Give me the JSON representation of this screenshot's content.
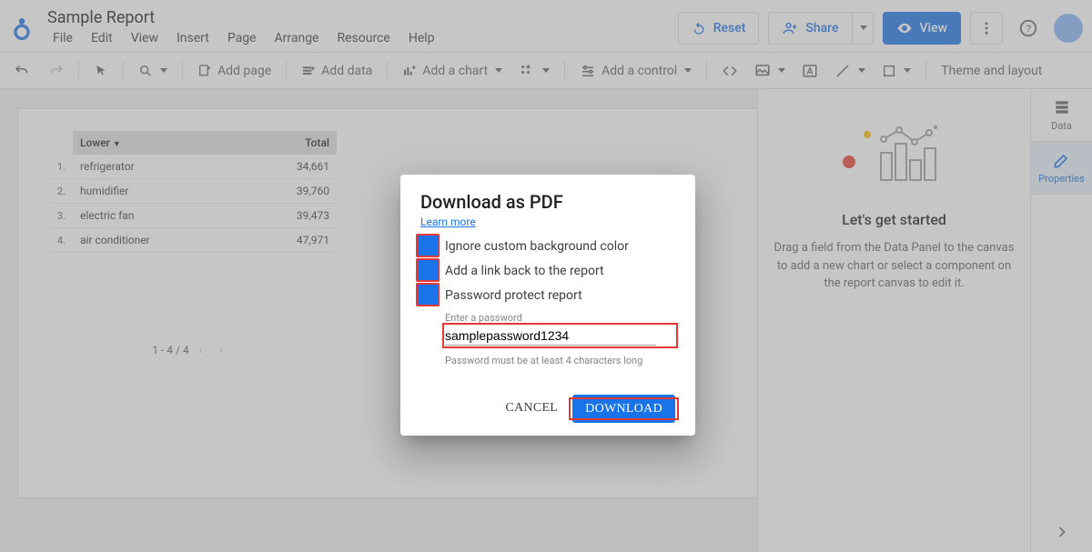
{
  "header": {
    "title": "Sample Report",
    "menus": [
      "File",
      "Edit",
      "View",
      "Insert",
      "Page",
      "Arrange",
      "Resource",
      "Help"
    ],
    "reset": "Reset",
    "share": "Share",
    "view": "View"
  },
  "toolbar": {
    "add_page": "Add page",
    "add_data": "Add data",
    "add_chart": "Add a chart",
    "add_control": "Add a control",
    "theme": "Theme and layout"
  },
  "table": {
    "col_sort": "Lower",
    "col_total": "Total",
    "rows": [
      {
        "i": "1.",
        "label": "refrigerator",
        "value": "34,661"
      },
      {
        "i": "2.",
        "label": "humidifier",
        "value": "39,760"
      },
      {
        "i": "3.",
        "label": "electric fan",
        "value": "39,473"
      },
      {
        "i": "4.",
        "label": "air conditioner",
        "value": "47,971"
      }
    ],
    "pager": "1 - 4 / 4"
  },
  "rightpanel": {
    "title": "Let's get started",
    "body": "Drag a field from the Data Panel to the canvas to add a new chart or select a component on the report canvas to edit it."
  },
  "minitabs": {
    "data": "Data",
    "properties": "Properties"
  },
  "dialog": {
    "title": "Download as PDF",
    "learn": "Learn more",
    "opt1": "Ignore custom background color",
    "opt2": "Add a link back to the report",
    "opt3": "Password protect report",
    "pw_label": "Enter a password",
    "pw_value": "samplepassword1234",
    "pw_hint": "Password must be at least 4 characters long",
    "cancel": "CANCEL",
    "download": "DOWNLOAD"
  }
}
